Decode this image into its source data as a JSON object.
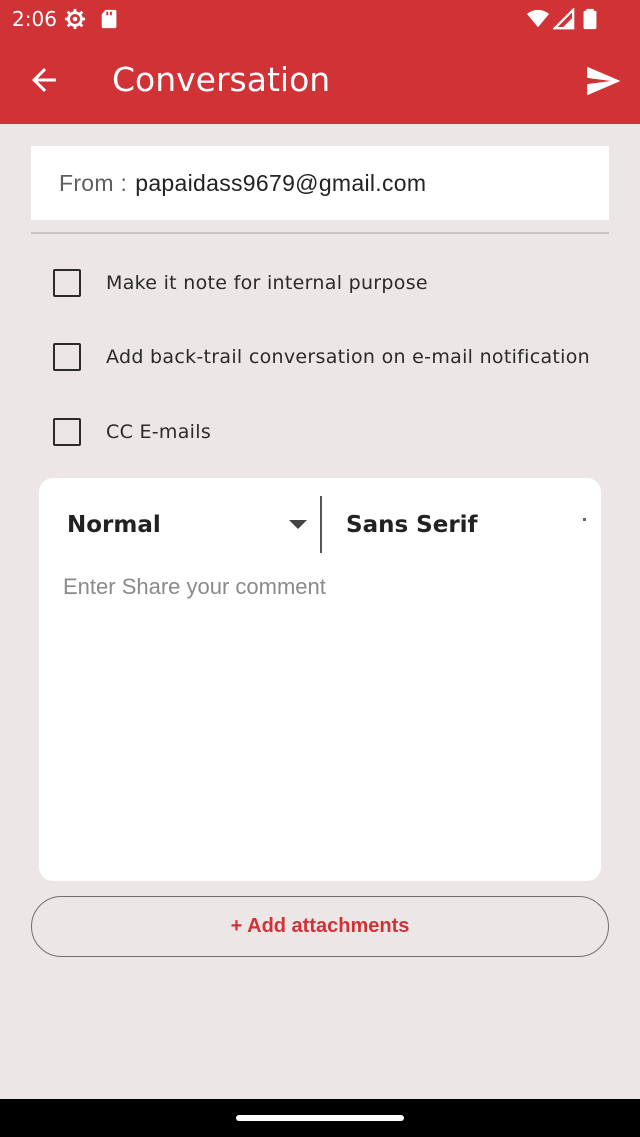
{
  "status_bar": {
    "time": "2:06",
    "icons": [
      "settings-gear-icon",
      "sd-card-icon",
      "wifi-icon",
      "signal-icon",
      "battery-icon"
    ]
  },
  "app_bar": {
    "title": "Conversation",
    "back_icon": "arrow-back-icon",
    "send_icon": "send-icon",
    "background_color": "#d13236"
  },
  "from": {
    "label": "From :",
    "value": "papaidass9679@gmail.com"
  },
  "options": [
    {
      "label": "Make it note for internal purpose",
      "checked": false
    },
    {
      "label": "Add back-trail conversation on e-mail notification",
      "checked": false
    },
    {
      "label": "CC E-mails",
      "checked": false
    }
  ],
  "editor": {
    "format_selected": "Normal",
    "font_selected": "Sans Serif",
    "placeholder": "Enter Share your comment",
    "value": ""
  },
  "attachments_button": {
    "label": "+ Add attachments",
    "color": "#d13236"
  }
}
